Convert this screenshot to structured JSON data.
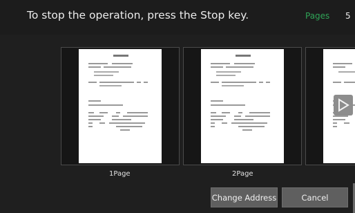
{
  "header": {
    "message": "To stop the operation, press the Stop key.",
    "pages_label": "Pages",
    "pages_count": "5"
  },
  "preview": {
    "thumbnails": [
      {
        "label": "1Page"
      },
      {
        "label": "2Page"
      },
      {
        "label": ""
      }
    ],
    "next_arrow_icon": "play-triangle-icon"
  },
  "actions": {
    "change_address_label": "Change Address",
    "cancel_label": "Cancel"
  },
  "colors": {
    "background": "#1f1f1f",
    "pages_label": "#2fa457",
    "button": "#5f5f5f"
  }
}
